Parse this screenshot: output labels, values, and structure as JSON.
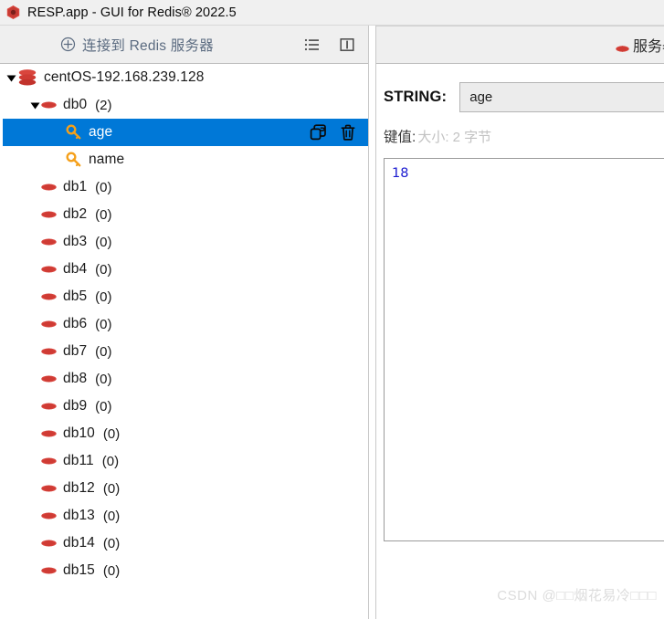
{
  "window": {
    "title": "RESP.app - GUI for Redis® 2022.5",
    "logo_icon": "redis-cube-icon"
  },
  "toolbar": {
    "connect_label": "连接到 Redis 服务器",
    "connect_icon": "plus-circle-icon",
    "list_icon": "list-view-icon",
    "split_icon": "split-pane-icon"
  },
  "tabbar": {
    "tab_label": "服务器",
    "tab_icon": "red-diamond-icon"
  },
  "tree": {
    "nodes": [
      {
        "label": "centOS-192.168.239.128",
        "count": "",
        "level": 0,
        "icon": "database-stack-icon",
        "expanded": true,
        "has_twisty": true,
        "selected": false
      },
      {
        "label": "db0",
        "count": "(2)",
        "level": 1,
        "icon": "red-diamond-icon",
        "expanded": true,
        "has_twisty": true,
        "selected": false
      },
      {
        "label": "age",
        "count": "",
        "level": 2,
        "icon": "orange-key-icon",
        "expanded": false,
        "has_twisty": false,
        "selected": true
      },
      {
        "label": "name",
        "count": "",
        "level": 2,
        "icon": "orange-key-icon",
        "expanded": false,
        "has_twisty": false,
        "selected": false
      },
      {
        "label": "db1",
        "count": "(0)",
        "level": 1,
        "icon": "red-diamond-icon",
        "expanded": false,
        "has_twisty": false,
        "selected": false
      },
      {
        "label": "db2",
        "count": "(0)",
        "level": 1,
        "icon": "red-diamond-icon",
        "expanded": false,
        "has_twisty": false,
        "selected": false
      },
      {
        "label": "db3",
        "count": "(0)",
        "level": 1,
        "icon": "red-diamond-icon",
        "expanded": false,
        "has_twisty": false,
        "selected": false
      },
      {
        "label": "db4",
        "count": "(0)",
        "level": 1,
        "icon": "red-diamond-icon",
        "expanded": false,
        "has_twisty": false,
        "selected": false
      },
      {
        "label": "db5",
        "count": "(0)",
        "level": 1,
        "icon": "red-diamond-icon",
        "expanded": false,
        "has_twisty": false,
        "selected": false
      },
      {
        "label": "db6",
        "count": "(0)",
        "level": 1,
        "icon": "red-diamond-icon",
        "expanded": false,
        "has_twisty": false,
        "selected": false
      },
      {
        "label": "db7",
        "count": "(0)",
        "level": 1,
        "icon": "red-diamond-icon",
        "expanded": false,
        "has_twisty": false,
        "selected": false
      },
      {
        "label": "db8",
        "count": "(0)",
        "level": 1,
        "icon": "red-diamond-icon",
        "expanded": false,
        "has_twisty": false,
        "selected": false
      },
      {
        "label": "db9",
        "count": "(0)",
        "level": 1,
        "icon": "red-diamond-icon",
        "expanded": false,
        "has_twisty": false,
        "selected": false
      },
      {
        "label": "db10",
        "count": "(0)",
        "level": 1,
        "icon": "red-diamond-icon",
        "expanded": false,
        "has_twisty": false,
        "selected": false
      },
      {
        "label": "db11",
        "count": "(0)",
        "level": 1,
        "icon": "red-diamond-icon",
        "expanded": false,
        "has_twisty": false,
        "selected": false
      },
      {
        "label": "db12",
        "count": "(0)",
        "level": 1,
        "icon": "red-diamond-icon",
        "expanded": false,
        "has_twisty": false,
        "selected": false
      },
      {
        "label": "db13",
        "count": "(0)",
        "level": 1,
        "icon": "red-diamond-icon",
        "expanded": false,
        "has_twisty": false,
        "selected": false
      },
      {
        "label": "db14",
        "count": "(0)",
        "level": 1,
        "icon": "red-diamond-icon",
        "expanded": false,
        "has_twisty": false,
        "selected": false
      },
      {
        "label": "db15",
        "count": "(0)",
        "level": 1,
        "icon": "red-diamond-icon",
        "expanded": false,
        "has_twisty": false,
        "selected": false
      }
    ],
    "row_actions": {
      "copy_icon": "copy-key-icon",
      "delete_icon": "trash-icon"
    }
  },
  "detail": {
    "type_label": "STRING:",
    "key_name": "age",
    "value_caption": "键值:",
    "size_caption": "大小: 2 字节",
    "value": "18"
  },
  "watermark": {
    "text": "CSDN @□□烟花易冷□□□"
  },
  "colors": {
    "selection": "#0078d7",
    "redis_red": "#d9453d",
    "key_orange": "#f5a01a",
    "value_blue": "#1a1ad0",
    "toolbar_bg": "#efefef",
    "link_text": "#5b6b80"
  }
}
